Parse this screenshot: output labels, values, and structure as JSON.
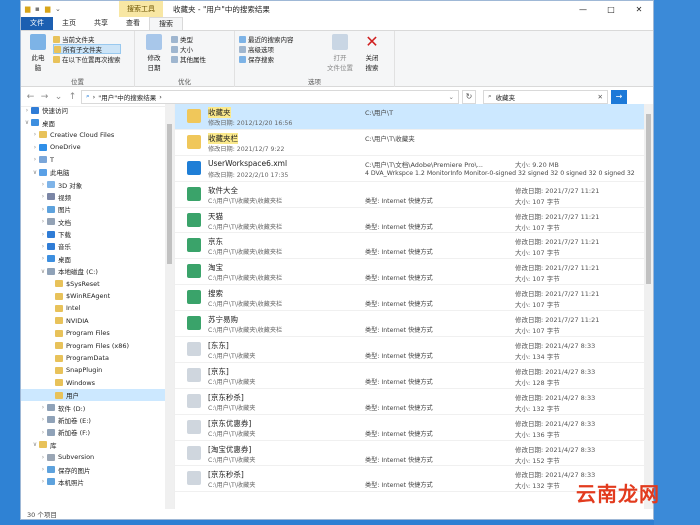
{
  "window": {
    "title": "收藏夹 - \"用户\"中的搜索结果",
    "context_tab": "搜索工具",
    "controls": [
      "—",
      "□",
      "✕"
    ]
  },
  "tabs": [
    {
      "label": "文件"
    },
    {
      "label": "主页"
    },
    {
      "label": "共享"
    },
    {
      "label": "查看"
    },
    {
      "label": "搜索"
    }
  ],
  "ribbon": {
    "group_location": {
      "name": "位置",
      "this_pc": "此电",
      "this_pc2": "脑",
      "current_folder": "当前文件夹",
      "all_subfolders": "所有子文件夹",
      "search_again": "在以下位置再次搜索"
    },
    "group_refine": {
      "name": "优化",
      "modified_date": "修改",
      "modified_date2": "日期",
      "type": "类型",
      "size": "大小",
      "other_props": "其他属性"
    },
    "group_options": {
      "name": "选项",
      "recent": "最近的搜索内容",
      "advanced": "高级选项",
      "save": "保存搜索",
      "open_location": "打开",
      "open_location2": "文件位置",
      "close": "关闭",
      "close2": "搜索"
    }
  },
  "address": {
    "path": "\"用户\"中的搜索结果",
    "search_value": "收藏夹"
  },
  "nav": [
    {
      "label": "快速访问",
      "level": 0,
      "exp": "›",
      "color": "#2f7cd6"
    },
    {
      "label": "桌面",
      "level": 0,
      "exp": "∨",
      "color": "#3d8fe0"
    },
    {
      "label": "Creative Cloud Files",
      "level": 1,
      "exp": "›",
      "color": "#e8c25a"
    },
    {
      "label": "OneDrive",
      "level": 1,
      "exp": "›",
      "color": "#2f8fe8"
    },
    {
      "label": "T",
      "level": 1,
      "exp": "›",
      "color": "#7aa6d9"
    },
    {
      "label": "此电脑",
      "level": 1,
      "exp": "∨",
      "color": "#5aa0e6"
    },
    {
      "label": "3D 对象",
      "level": 2,
      "exp": "›",
      "color": "#7fb4e8"
    },
    {
      "label": "视频",
      "level": 2,
      "exp": "›",
      "color": "#7b86a6"
    },
    {
      "label": "图片",
      "level": 2,
      "exp": "›",
      "color": "#5da2dd"
    },
    {
      "label": "文档",
      "level": 2,
      "exp": "›",
      "color": "#93a2b5"
    },
    {
      "label": "下载",
      "level": 2,
      "exp": "›",
      "color": "#2f7cd6"
    },
    {
      "label": "音乐",
      "level": 2,
      "exp": "›",
      "color": "#2f7cd6"
    },
    {
      "label": "桌面",
      "level": 2,
      "exp": "›",
      "color": "#3d8fe0"
    },
    {
      "label": "本地磁盘 (C:)",
      "level": 2,
      "exp": "∨",
      "color": "#8fa2b8"
    },
    {
      "label": "$SysReset",
      "level": 3,
      "exp": "",
      "color": "#e8c25a"
    },
    {
      "label": "$WinREAgent",
      "level": 3,
      "exp": "",
      "color": "#e8c25a"
    },
    {
      "label": "Intel",
      "level": 3,
      "exp": "",
      "color": "#e8c25a"
    },
    {
      "label": "NVIDIA",
      "level": 3,
      "exp": "",
      "color": "#e8c25a"
    },
    {
      "label": "Program Files",
      "level": 3,
      "exp": "",
      "color": "#e8c25a"
    },
    {
      "label": "Program Files (x86)",
      "level": 3,
      "exp": "",
      "color": "#e8c25a"
    },
    {
      "label": "ProgramData",
      "level": 3,
      "exp": "",
      "color": "#e8c25a"
    },
    {
      "label": "SnapPlugin",
      "level": 3,
      "exp": "",
      "color": "#e8c25a"
    },
    {
      "label": "Windows",
      "level": 3,
      "exp": "",
      "color": "#e8c25a"
    },
    {
      "label": "用户",
      "level": 3,
      "exp": "",
      "color": "#e8c25a",
      "selected": true
    },
    {
      "label": "软件 (D:)",
      "level": 2,
      "exp": "›",
      "color": "#8fa2b8"
    },
    {
      "label": "新加卷 (E:)",
      "level": 2,
      "exp": "›",
      "color": "#8fa2b8"
    },
    {
      "label": "新加卷 (F:)",
      "level": 2,
      "exp": "›",
      "color": "#8fa2b8"
    },
    {
      "label": "库",
      "level": 1,
      "exp": "∨",
      "color": "#e8c25a"
    },
    {
      "label": "Subversion",
      "level": 2,
      "exp": "›",
      "color": "#9aa6b5"
    },
    {
      "label": "保存的图片",
      "level": 2,
      "exp": "›",
      "color": "#5da2dd"
    },
    {
      "label": "本机照片",
      "level": 2,
      "exp": "›",
      "color": "#5da2dd"
    }
  ],
  "results": [
    {
      "name": "收藏夹",
      "name_hl": true,
      "sub": "修改日期: 2012/12/20 16:56",
      "mid": "C:\\用户\\T",
      "mid2": "",
      "rt": "",
      "rt2": "",
      "icon": "#f0c75a",
      "selected": true
    },
    {
      "name": "收藏夹栏",
      "name_hl": true,
      "sub": "修改日期: 2021/12/7 9:22",
      "mid": "C:\\用户\\T\\收藏夹",
      "mid2": "",
      "rt": "",
      "rt2": "",
      "icon": "#f0c75a"
    },
    {
      "name": "UserWorkspace6.xml",
      "name_hl": false,
      "sub": "修改日期: 2022/2/10 17:35",
      "mid": "C:\\用户\\T\\文档\\Adobe\\Premiere Pro\\...",
      "mid2": "4 DVA_Wrkspce 1.2 MonitorInfo Monitor-0-signed 32 signed 32 0 signed 32 0 signed 32",
      "rt": "大小: 9.20 MB",
      "rt2": "",
      "icon": "#1f7ed6"
    },
    {
      "name": "软件大全",
      "name_hl": false,
      "sub": "C:\\用户\\T\\收藏夹\\收藏夹栏",
      "mid": "",
      "mid2": "类型: Internet 快捷方式",
      "rt": "修改日期: 2021/7/27 11:21",
      "rt2": "大小: 107 字节",
      "icon": "#3aa36a"
    },
    {
      "name": "天猫",
      "name_hl": false,
      "sub": "C:\\用户\\T\\收藏夹\\收藏夹栏",
      "mid": "",
      "mid2": "类型: Internet 快捷方式",
      "rt": "修改日期: 2021/7/27 11:21",
      "rt2": "大小: 107 字节",
      "icon": "#3aa36a"
    },
    {
      "name": "京东",
      "name_hl": false,
      "sub": "C:\\用户\\T\\收藏夹\\收藏夹栏",
      "mid": "",
      "mid2": "类型: Internet 快捷方式",
      "rt": "修改日期: 2021/7/27 11:21",
      "rt2": "大小: 107 字节",
      "icon": "#3aa36a"
    },
    {
      "name": "淘宝",
      "name_hl": false,
      "sub": "C:\\用户\\T\\收藏夹\\收藏夹栏",
      "mid": "",
      "mid2": "类型: Internet 快捷方式",
      "rt": "修改日期: 2021/7/27 11:21",
      "rt2": "大小: 107 字节",
      "icon": "#3aa36a"
    },
    {
      "name": "搜索",
      "name_hl": false,
      "sub": "C:\\用户\\T\\收藏夹\\收藏夹栏",
      "mid": "",
      "mid2": "类型: Internet 快捷方式",
      "rt": "修改日期: 2021/7/27 11:21",
      "rt2": "大小: 107 字节",
      "icon": "#3aa36a"
    },
    {
      "name": "苏宁易购",
      "name_hl": false,
      "sub": "C:\\用户\\T\\收藏夹\\收藏夹栏",
      "mid": "",
      "mid2": "类型: Internet 快捷方式",
      "rt": "修改日期: 2021/7/27 11:21",
      "rt2": "大小: 107 字节",
      "icon": "#3aa36a"
    },
    {
      "name": "[东东]",
      "name_hl": false,
      "sub": "C:\\用户\\T\\收藏夹",
      "mid": "",
      "mid2": "类型: Internet 快捷方式",
      "rt": "修改日期: 2021/4/27 8:33",
      "rt2": "大小: 134 字节",
      "icon": "#cfd6de"
    },
    {
      "name": "[京东]",
      "name_hl": false,
      "sub": "C:\\用户\\T\\收藏夹",
      "mid": "",
      "mid2": "类型: Internet 快捷方式",
      "rt": "修改日期: 2021/4/27 8:33",
      "rt2": "大小: 128 字节",
      "icon": "#cfd6de"
    },
    {
      "name": "[京东秒杀]",
      "name_hl": false,
      "sub": "C:\\用户\\T\\收藏夹",
      "mid": "",
      "mid2": "类型: Internet 快捷方式",
      "rt": "修改日期: 2021/4/27 8:33",
      "rt2": "大小: 132 字节",
      "icon": "#cfd6de"
    },
    {
      "name": "[京东优惠券]",
      "name_hl": false,
      "sub": "C:\\用户\\T\\收藏夹",
      "mid": "",
      "mid2": "类型: Internet 快捷方式",
      "rt": "修改日期: 2021/4/27 8:33",
      "rt2": "大小: 136 字节",
      "icon": "#cfd6de"
    },
    {
      "name": "[淘宝优惠券]",
      "name_hl": false,
      "sub": "C:\\用户\\T\\收藏夹",
      "mid": "",
      "mid2": "类型: Internet 快捷方式",
      "rt": "修改日期: 2021/4/27 8:33",
      "rt2": "大小: 152 字节",
      "icon": "#cfd6de"
    },
    {
      "name": "[京东秒杀]",
      "name_hl": false,
      "sub": "C:\\用户\\T\\收藏夹",
      "mid": "",
      "mid2": "类型: Internet 快捷方式",
      "rt": "修改日期: 2021/4/27 8:33",
      "rt2": "大小: 132 字节",
      "icon": "#cfd6de"
    }
  ],
  "status": "30 个项目",
  "watermark": "云南龙网"
}
